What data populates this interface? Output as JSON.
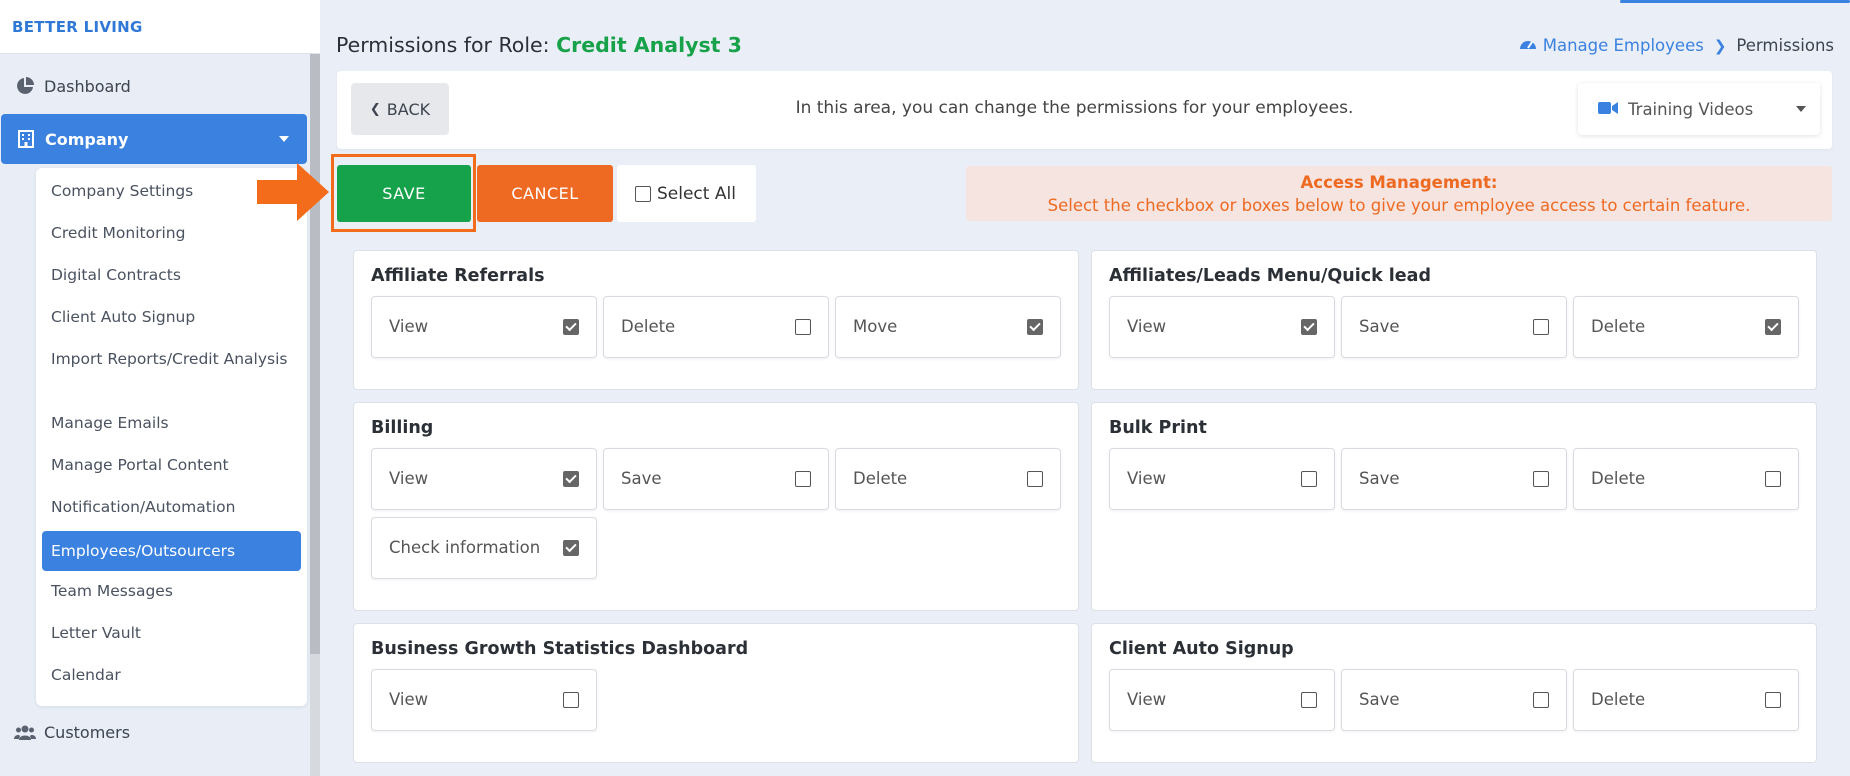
{
  "brand": "BETTER LIVING",
  "nav": {
    "dashboard": "Dashboard",
    "company": "Company",
    "customers": "Customers",
    "submenu": [
      "Company Settings",
      "Credit Monitoring",
      "Digital Contracts",
      "Client Auto Signup",
      "Import Reports/Credit Analysis",
      "Manage Emails",
      "Manage Portal Content",
      "Notification/Automation",
      "Employees/Outsourcers",
      "Team Messages",
      "Letter Vault",
      "Calendar"
    ],
    "active_sub": "Employees/Outsourcers"
  },
  "header": {
    "title_prefix": "Permissions for Role: ",
    "role": "Credit Analyst 3",
    "breadcrumb_link": "Manage Employees",
    "breadcrumb_current": "Permissions"
  },
  "toolbar": {
    "back": "BACK",
    "message": "In this area, you can change the permissions for your employees.",
    "training": "Training Videos",
    "save": "SAVE",
    "cancel": "CANCEL",
    "select_all": "Select All",
    "access_title": "Access Management:",
    "access_text": "Select the checkbox or boxes below to give your employee access to certain feature."
  },
  "colors": {
    "accent": "#3b82e0",
    "save": "#16a24b",
    "cancel": "#ee6a22",
    "highlight": "#f26c1c"
  },
  "cards": [
    {
      "title": "Affiliate Referrals",
      "perms": [
        {
          "label": "View",
          "checked": true
        },
        {
          "label": "Delete",
          "checked": false
        },
        {
          "label": "Move",
          "checked": true
        }
      ]
    },
    {
      "title": "Affiliates/Leads Menu/Quick lead",
      "perms": [
        {
          "label": "View",
          "checked": true
        },
        {
          "label": "Save",
          "checked": false
        },
        {
          "label": "Delete",
          "checked": true
        }
      ]
    },
    {
      "title": "Billing",
      "perms": [
        {
          "label": "View",
          "checked": true
        },
        {
          "label": "Save",
          "checked": false
        },
        {
          "label": "Delete",
          "checked": false
        },
        {
          "label": "Check information",
          "checked": true
        }
      ]
    },
    {
      "title": "Bulk Print",
      "perms": [
        {
          "label": "View",
          "checked": false
        },
        {
          "label": "Save",
          "checked": false
        },
        {
          "label": "Delete",
          "checked": false
        }
      ]
    },
    {
      "title": "Business Growth Statistics Dashboard",
      "perms": [
        {
          "label": "View",
          "checked": false
        }
      ]
    },
    {
      "title": "Client Auto Signup",
      "perms": [
        {
          "label": "View",
          "checked": false
        },
        {
          "label": "Save",
          "checked": false
        },
        {
          "label": "Delete",
          "checked": false
        }
      ]
    }
  ]
}
